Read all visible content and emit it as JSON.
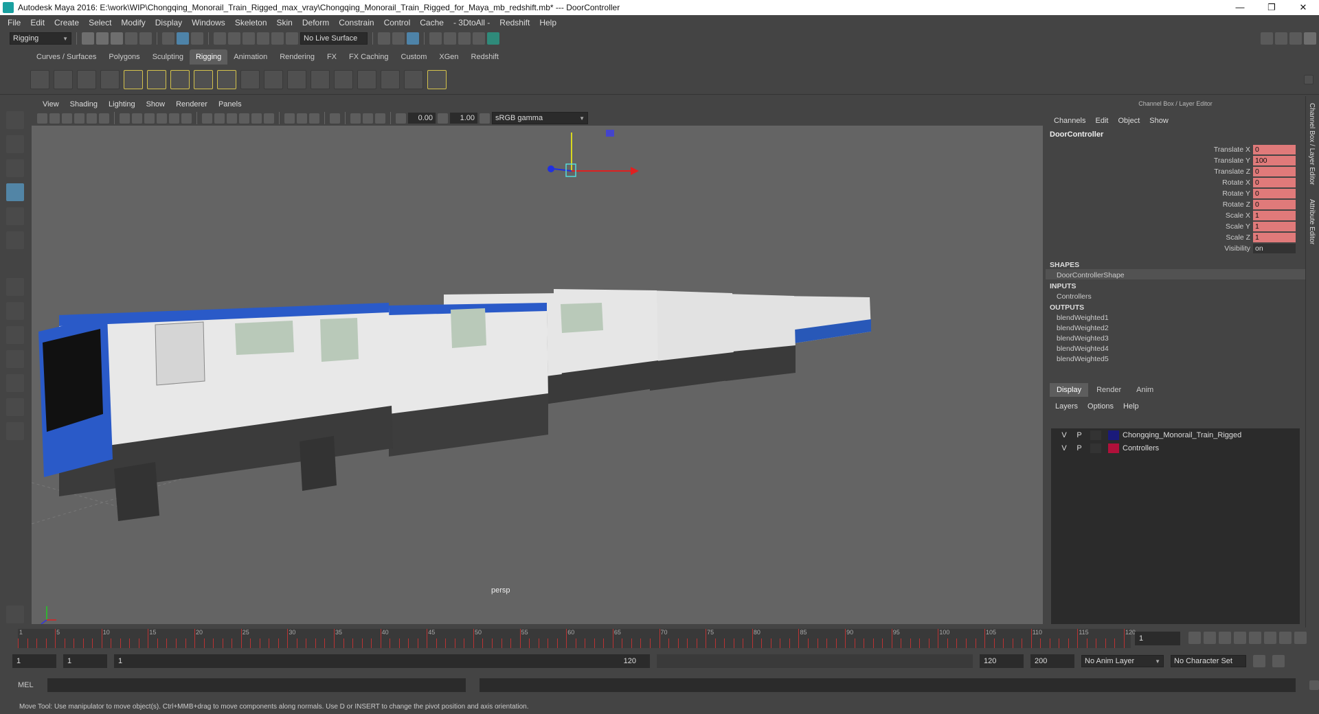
{
  "window": {
    "title": "Autodesk Maya 2016: E:\\work\\WIP\\Chongqing_Monorail_Train_Rigged_max_vray\\Chongqing_Monorail_Train_Rigged_for_Maya_mb_redshift.mb*  ---  DoorController",
    "min": "—",
    "max": "❐",
    "close": "✕"
  },
  "menu": [
    "File",
    "Edit",
    "Create",
    "Select",
    "Modify",
    "Display",
    "Windows",
    "Skeleton",
    "Skin",
    "Deform",
    "Constrain",
    "Control",
    "Cache",
    "- 3DtoAll -",
    "Redshift",
    "Help"
  ],
  "status": {
    "mode": "Rigging",
    "live_surface": "No Live Surface"
  },
  "shelf_tabs": [
    "Curves / Surfaces",
    "Polygons",
    "Sculpting",
    "Rigging",
    "Animation",
    "Rendering",
    "FX",
    "FX Caching",
    "Custom",
    "XGen",
    "Redshift"
  ],
  "active_shelf": "Rigging",
  "panel_menu": [
    "View",
    "Shading",
    "Lighting",
    "Show",
    "Renderer",
    "Panels"
  ],
  "panel_toolbar": {
    "exposure": "0.00",
    "gamma": "1.00",
    "colorspace": "sRGB gamma"
  },
  "viewport": {
    "camera": "persp"
  },
  "channel_box": {
    "header": "Channel Box / Layer Editor",
    "menu": [
      "Channels",
      "Edit",
      "Object",
      "Show"
    ],
    "object": "DoorController",
    "attrs": [
      {
        "name": "Translate X",
        "value": "0"
      },
      {
        "name": "Translate Y",
        "value": "100"
      },
      {
        "name": "Translate Z",
        "value": "0"
      },
      {
        "name": "Rotate X",
        "value": "0"
      },
      {
        "name": "Rotate Y",
        "value": "0"
      },
      {
        "name": "Rotate Z",
        "value": "0"
      },
      {
        "name": "Scale X",
        "value": "1"
      },
      {
        "name": "Scale Y",
        "value": "1"
      },
      {
        "name": "Scale Z",
        "value": "1"
      },
      {
        "name": "Visibility",
        "value": "on"
      }
    ],
    "shapes_label": "SHAPES",
    "shape": "DoorControllerShape",
    "inputs_label": "INPUTS",
    "input": "Controllers",
    "outputs_label": "OUTPUTS",
    "outputs": [
      "blendWeighted1",
      "blendWeighted2",
      "blendWeighted3",
      "blendWeighted4",
      "blendWeighted5"
    ]
  },
  "vertical_tabs": [
    "Channel Box / Layer Editor",
    "Attribute Editor"
  ],
  "layer_editor": {
    "tabs": [
      "Display",
      "Render",
      "Anim"
    ],
    "menu": [
      "Layers",
      "Options",
      "Help"
    ],
    "layers": [
      {
        "v": "V",
        "p": "P",
        "name": "Chongqing_Monorail_Train_Rigged",
        "color": "#1a1a7a"
      },
      {
        "v": "V",
        "p": "P",
        "name": "Controllers",
        "color": "#b0103a"
      }
    ]
  },
  "timeline": {
    "ticks": [
      "1",
      "5",
      "10",
      "15",
      "20",
      "25",
      "30",
      "35",
      "40",
      "45",
      "50",
      "55",
      "60",
      "65",
      "70",
      "75",
      "80",
      "85",
      "90",
      "95",
      "100",
      "105",
      "110",
      "115",
      "120"
    ],
    "current": "1"
  },
  "range": {
    "start": "1",
    "anim_start": "1",
    "slider_start": "1",
    "slider_end": "120",
    "end": "120",
    "anim_end": "200",
    "anim_layer": "No Anim Layer",
    "char_set": "No Character Set"
  },
  "cmd": {
    "label": "MEL"
  },
  "help": "Move Tool: Use manipulator to move object(s). Ctrl+MMB+drag to move components along normals. Use D or INSERT to change the pivot position and axis orientation."
}
